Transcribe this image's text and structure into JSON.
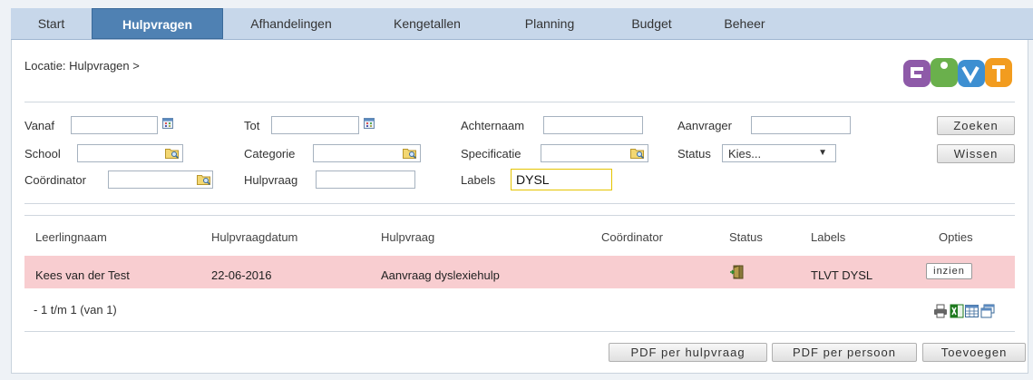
{
  "nav": {
    "tabs": [
      {
        "label": "Start",
        "active": false
      },
      {
        "label": "Hulpvragen",
        "active": true
      },
      {
        "label": "Afhandelingen",
        "active": false
      },
      {
        "label": "Kengetallen",
        "active": false
      },
      {
        "label": "Planning",
        "active": false
      },
      {
        "label": "Budget",
        "active": false
      },
      {
        "label": "Beheer",
        "active": false
      }
    ]
  },
  "breadcrumb": "Locatie: Hulpvragen >",
  "filters": {
    "vanaf_label": "Vanaf",
    "tot_label": "Tot",
    "achternaam_label": "Achternaam",
    "aanvrager_label": "Aanvrager",
    "school_label": "School",
    "categorie_label": "Categorie",
    "specificatie_label": "Specificatie",
    "status_label": "Status",
    "status_value": "Kies...",
    "coordinator_label": "Coördinator",
    "hulpvraag_label": "Hulpvraag",
    "labels_label": "Labels",
    "labels_value": "DYSL",
    "zoeken": "Zoeken",
    "wissen": "Wissen"
  },
  "table": {
    "headers": [
      "Leerlingnaam",
      "Hulpvraagdatum",
      "Hulpvraag",
      "Coördinator",
      "Status",
      "Labels",
      "Opties"
    ],
    "rows": [
      {
        "leerlingnaam": "Kees van der Test",
        "datum": "22-06-2016",
        "hulpvraag": "Aanvraag dyslexiehulp",
        "coordinator": "",
        "labels": "TLVT DYSL",
        "optie": "inzien"
      }
    ],
    "count": "- 1 t/m 1 (van 1)"
  },
  "footer": {
    "pdf_hulpvraag": "PDF per hulpvraag",
    "pdf_persoon": "PDF per persoon",
    "toevoegen": "Toevoegen"
  },
  "colors": {
    "nav_bg": "#c7d7ea",
    "nav_active": "#4f81b3",
    "row_highlight": "#f8cdd0",
    "label_border": "#e5c400"
  }
}
